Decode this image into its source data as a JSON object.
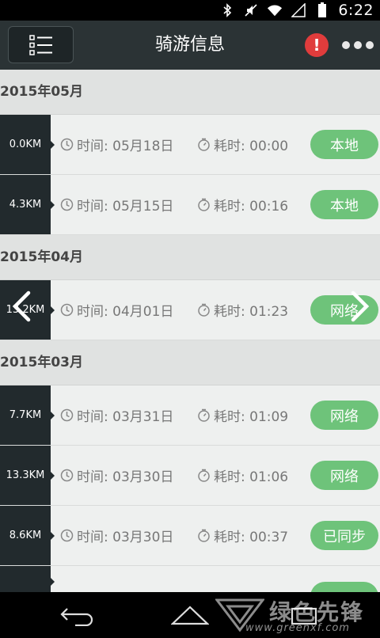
{
  "status_bar": {
    "time": "6:22",
    "icons": [
      "bluetooth-icon",
      "mute-icon",
      "wifi-icon",
      "signal-icon",
      "battery-icon"
    ]
  },
  "header": {
    "title": "骑游信息",
    "alert_glyph": "!",
    "colors": {
      "background": "#2b3335",
      "alert": "#e03c3c"
    }
  },
  "sections": [
    {
      "month": "2015年05月",
      "rides": [
        {
          "distance": "0.0KM",
          "time": "时间: 05月18日",
          "duration": "耗时: 00:00",
          "tag": "本地"
        },
        {
          "distance": "4.3KM",
          "time": "时间: 05月15日",
          "duration": "耗时: 00:16",
          "tag": "本地"
        }
      ]
    },
    {
      "month": "2015年04月",
      "rides": [
        {
          "distance": "13.2KM",
          "time": "时间: 04月01日",
          "duration": "耗时: 01:23",
          "tag": "网络"
        }
      ]
    },
    {
      "month": "2015年03月",
      "rides": [
        {
          "distance": "7.7KM",
          "time": "时间: 03月31日",
          "duration": "耗时: 01:09",
          "tag": "网络"
        },
        {
          "distance": "13.3KM",
          "time": "时间: 03月30日",
          "duration": "耗时: 01:06",
          "tag": "网络"
        },
        {
          "distance": "8.6KM",
          "time": "时间: 03月30日",
          "duration": "耗时: 00:37",
          "tag": "已同步"
        }
      ]
    }
  ],
  "watermark": {
    "text": "绿色先锋",
    "url": "www.greenxf.com"
  },
  "colors": {
    "tag_green": "#6ec37a",
    "distance_bg": "#222a2d",
    "month_bg": "#e0e2e1"
  }
}
